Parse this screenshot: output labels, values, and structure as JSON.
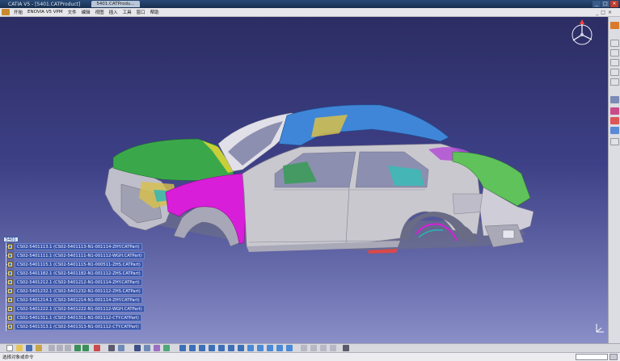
{
  "window": {
    "title": "CATIA V5 - [5401.CATProduct]",
    "tab": "5401.CATProdu...",
    "controls": [
      "_",
      "□",
      "×"
    ]
  },
  "menu": {
    "items": [
      "开始",
      "ENOVIA V5 VPM",
      "文件",
      "编辑",
      "视图",
      "插入",
      "工具",
      "窗口",
      "帮助"
    ],
    "window_controls": [
      "_",
      "□",
      "×"
    ]
  },
  "tree": {
    "root": "5401",
    "items": [
      "CS02-5401113.1 (CS02-5401113-N1-001114-ZHY.CATPart)",
      "CS02-5401111.1 (CS02-5401111-N1-001112-WGH.CATPart)",
      "CS02-5401115.1 (CS02-5401115-N1-000511-ZHS.CATPart)",
      "CS02-5401182.1 (CS02-5401182-N1-001112-ZHS.CATPart)",
      "CS02-5401212.1 (CS02-5401212-N1-001114-ZHY.CATPart)",
      "CS02-5401232.1 (CS02-5401232-N1-001112-ZHS.CATPart)",
      "CS02-5401214.1 (CS02-5401214-N1-001114-ZHY.CATPart)",
      "CS02-5401222.1 (CS02-5401222-N1-001112-WGH.CATPart)",
      "CS02-5401311.1 (CS02-5401311-N1-001112-CTY.CATPart)",
      "CS02-5401313.1 (CS02-5401313-N1-001112-CTY.CATPart)"
    ]
  },
  "status": {
    "text": "选择对象或命令"
  },
  "colors": {
    "viewport_top": "#2c2d63",
    "viewport_bottom": "#8a8fc8",
    "body_gray": "#c9c8cf",
    "hood_green": "#3aa84a",
    "roof_blue": "#3f86d8",
    "fender_magenta": "#d81ed8",
    "trunk_green": "#5fc25b",
    "tree_highlight": "#3a55a8"
  },
  "icons": {
    "compass": "compass-icon",
    "part": "part-icon",
    "axis": "axis-icon"
  }
}
